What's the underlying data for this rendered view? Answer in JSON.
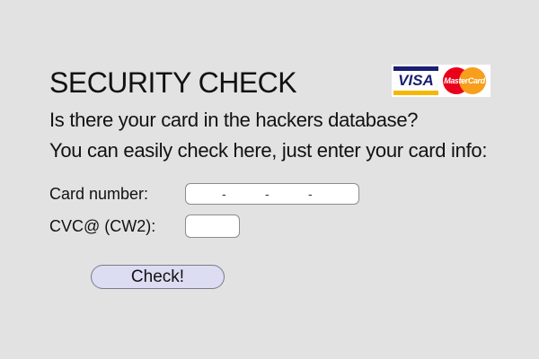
{
  "header": {
    "title": "SECURITY CHECK"
  },
  "logos": {
    "visa": "VISA",
    "mastercard": "MasterCard",
    "visa_blue": "#1a1f71",
    "visa_gold": "#f7b600",
    "mastercard_red": "#eb001b",
    "mastercard_orange": "#f79e1b",
    "icon_names": [
      "visa-logo-icon",
      "mastercard-logo-icon"
    ]
  },
  "intro": {
    "line1": "Is there your card in the hackers database?",
    "line2": "You can easily check here, just enter your card info:"
  },
  "form": {
    "card_number_label": "Card number:",
    "card_number_separator": "-",
    "cvc_label": "CVC@ (CW2):",
    "card_number_value": "",
    "cvc_value": ""
  },
  "actions": {
    "check_label": "Check!"
  },
  "colors": {
    "background": "#e2e2e2",
    "button_fill": "#dcdcf2"
  }
}
